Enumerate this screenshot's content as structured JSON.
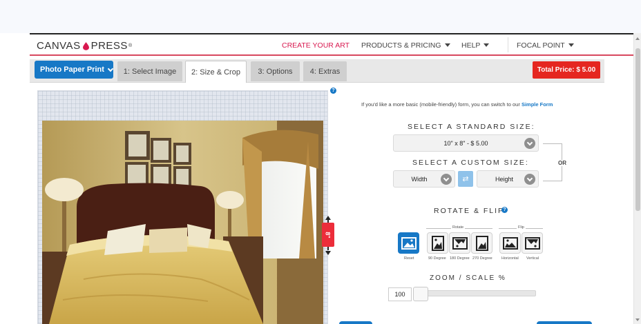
{
  "brand": {
    "logo_left": "CANVAS",
    "logo_right": "PRESS",
    "logo_mark": "®",
    "accent_color": "#d8475e",
    "primary_color": "#1778c6",
    "price_color": "#e52620"
  },
  "nav": {
    "create": "CREATE YOUR ART",
    "products": "PRODUCTS & PRICING",
    "help": "HELP",
    "focal": "FOCAL POINT"
  },
  "tabs": {
    "product_select": "Photo Paper Print",
    "steps": [
      "1: Select Image",
      "2: Size & Crop",
      "3: Options",
      "4: Extras"
    ],
    "active_step": "2: Size & Crop",
    "total_price": "Total Price: $ 5.00"
  },
  "form": {
    "switch_text": "If you'd like a more basic (mobile-friendly) form, you can switch to our",
    "switch_link": "Simple Form",
    "standard_title": "SELECT A STANDARD SIZE:",
    "standard_value": "10\" x 8\" - $ 5.00",
    "custom_title": "SELECT A CUSTOM SIZE:",
    "width_placeholder": "Width",
    "height_placeholder": "Height",
    "or_label": "OR"
  },
  "canvas": {
    "height_handle": "8\""
  },
  "rotate": {
    "title": "ROTATE & FLIP",
    "rotate_group": "Rotate",
    "flip_group": "Flip",
    "buttons": {
      "reset": "Reset",
      "r90": "90 Degree",
      "r180": "180 Degree",
      "r270": "270 Degree",
      "horizontal": "Horizontal",
      "vertical": "Vertical"
    }
  },
  "zoom": {
    "title": "ZOOM / SCALE %",
    "value": "100"
  },
  "icons": [
    "ink-drop-icon",
    "caret-down-icon",
    "chevron-down-icon",
    "help-icon",
    "swap-icon",
    "image-icon",
    "rotate-icon",
    "flip-icon"
  ]
}
